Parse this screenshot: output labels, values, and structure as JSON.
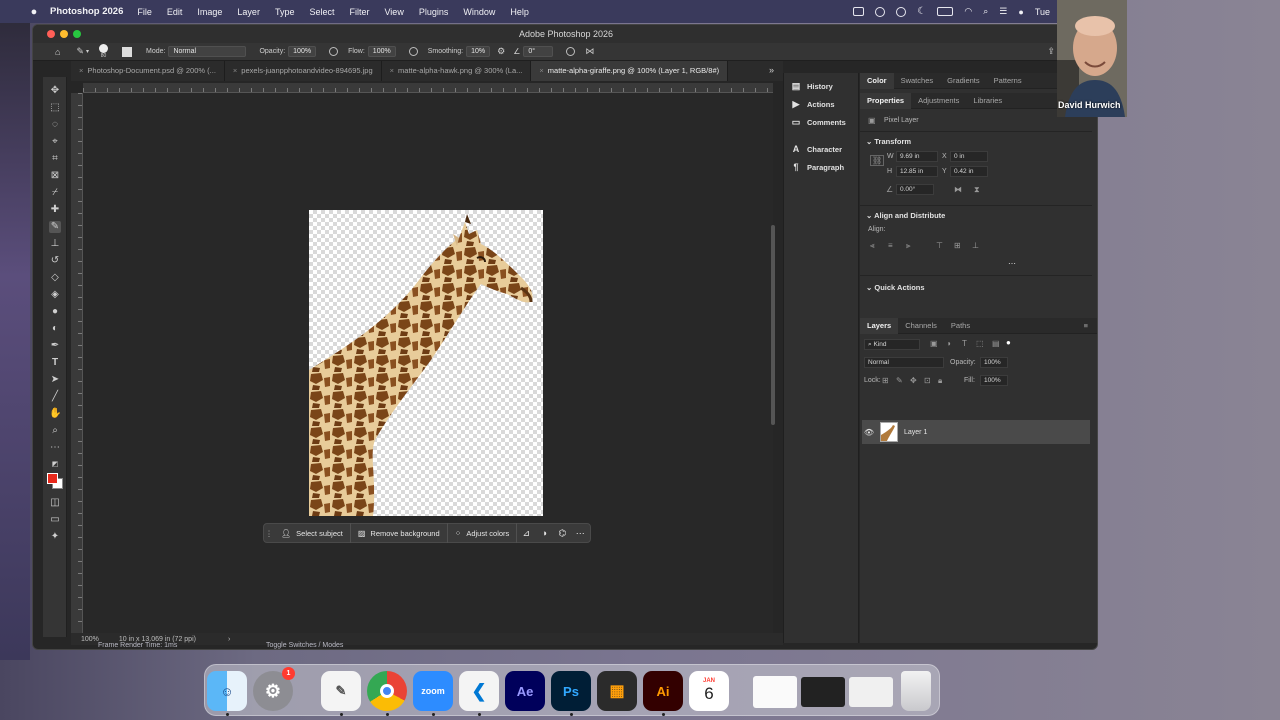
{
  "menubar": {
    "app_name": "Photoshop 2026",
    "items": [
      "File",
      "Edit",
      "Image",
      "Layer",
      "Type",
      "Select",
      "Filter",
      "View",
      "Plugins",
      "Window",
      "Help"
    ],
    "clock": "Tue"
  },
  "window": {
    "title": "Adobe Photoshop 2026"
  },
  "options_bar": {
    "brush_size": "80",
    "mode_label": "Mode:",
    "mode_value": "Normal",
    "opacity_label": "Opacity:",
    "opacity_value": "100%",
    "flow_label": "Flow:",
    "flow_value": "100%",
    "smoothing_label": "Smoothing:",
    "smoothing_value": "10%",
    "angle_value": "0°"
  },
  "tabs": [
    {
      "label": "Photoshop-Document.psd @ 200% (..."
    },
    {
      "label": "pexels-juanpphotoandvideo-894695.jpg"
    },
    {
      "label": "matte-alpha-hawk.png @ 300% (La..."
    },
    {
      "label": "matte-alpha-giraffe.png @ 100% (Layer 1, RGB/8#)"
    }
  ],
  "context_bar": {
    "select_subject": "Select subject",
    "remove_background": "Remove background",
    "adjust_colors": "Adjust colors"
  },
  "status": {
    "zoom": "100%",
    "doc_size": "10 in x 13.069 in (72 ppi)",
    "frame_render": "Frame Render Time:  1ms",
    "toggle": "Toggle Switches / Modes"
  },
  "dock_panels": [
    "History",
    "Actions",
    "Comments",
    "Character",
    "Paragraph"
  ],
  "color_tabs": [
    "Color",
    "Swatches",
    "Gradients",
    "Patterns"
  ],
  "properties_tabs": [
    "Properties",
    "Adjustments",
    "Libraries"
  ],
  "properties": {
    "layer_kind": "Pixel Layer",
    "transform_title": "Transform",
    "w_label": "W",
    "w_value": "9.69 in",
    "h_label": "H",
    "h_value": "12.85 in",
    "x_label": "X",
    "x_value": "0 in",
    "y_label": "Y",
    "y_value": "0.42 in",
    "angle_value": "0.00°",
    "align_title": "Align and Distribute",
    "align_label": "Align:",
    "quick_actions": "Quick Actions"
  },
  "layers_tabs": [
    "Layers",
    "Channels",
    "Paths"
  ],
  "layers": {
    "kind": "Kind",
    "blend": "Normal",
    "opacity_label": "Opacity:",
    "opacity_value": "100%",
    "lock_label": "Lock:",
    "fill_label": "Fill:",
    "fill_value": "100%",
    "layer_name": "Layer 1"
  },
  "webcam": {
    "name": "David Hurwich"
  },
  "dock_apps": {
    "notif_badge": "1",
    "zoom": "zoom",
    "ae": "Ae",
    "ps": "Ps",
    "ai": "Ai",
    "cal_month": "JAN",
    "cal_day": "6"
  },
  "colors": {
    "foreground": "#e8291c",
    "background": "#ffffff",
    "ps_blue": "#31a8ff",
    "ps_dark": "#001e36",
    "ae_purple": "#9999ff",
    "ai_orange": "#ff9a00"
  }
}
